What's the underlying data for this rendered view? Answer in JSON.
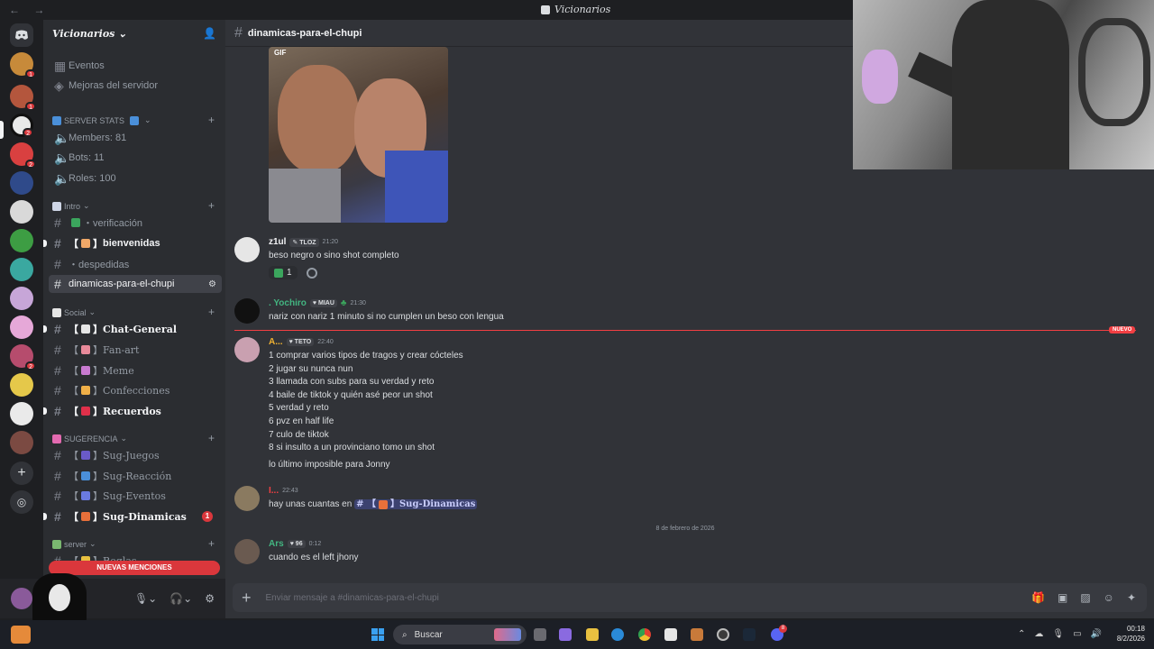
{
  "window": {
    "title": "Vicionarios",
    "nav": "← →"
  },
  "server": {
    "name": "Vicionarios"
  },
  "sidebar": {
    "top_items": [
      {
        "icon": "calendar-icon",
        "label": "Eventos"
      },
      {
        "icon": "boost-icon",
        "label": "Mejoras del servidor"
      }
    ],
    "categories": {
      "stats": "SERVER STATS",
      "intro": "Intro",
      "social": "Social",
      "sugerencia": "SUGERENCIA",
      "server": "server"
    },
    "stats_channels": [
      "Members: 81",
      "Bots: 11",
      "Roles: 100"
    ],
    "intro_channels": [
      {
        "name": "・verificación"
      },
      {
        "name": "bienvenidas",
        "bracket": true
      },
      {
        "name": "・despedidas"
      },
      {
        "name": "dinamicas-para-el-chupi"
      }
    ],
    "social_channels": [
      {
        "name": "Chat-General"
      },
      {
        "name": "Fan-art"
      },
      {
        "name": "Meme"
      },
      {
        "name": "Confecciones"
      },
      {
        "name": "Recuerdos"
      }
    ],
    "sug_channels": [
      {
        "name": "Sug-Juegos"
      },
      {
        "name": "Sug-Reacción"
      },
      {
        "name": "Sug-Eventos"
      },
      {
        "name": "Sug-Dinamicas",
        "mentions": "1"
      }
    ],
    "server_channels": [
      {
        "name": "Reglas"
      }
    ],
    "new_mentions": "NUEVAS MENCIONES"
  },
  "guild_badges": [
    "1",
    "1",
    "2",
    "2",
    "2"
  ],
  "channel": {
    "name": "dinamicas-para-el-chupi"
  },
  "messages": {
    "gif_label": "GIF",
    "m1": {
      "user": "z1ul",
      "tag": "TLOZ",
      "time": "21:20",
      "text": "beso negro o sino shot completo",
      "reaction_count": "1"
    },
    "m2": {
      "user": ". Yochiro",
      "tag": "MIAU",
      "time": "21:30",
      "text": "nariz con nariz 1 minuto si no cumplen un beso con lengua"
    },
    "new_label": "NUEVO",
    "m3": {
      "user": "A...",
      "tag": "TETO",
      "time": "22:40",
      "lines": [
        "1 comprar varios tipos de tragos y crear cócteles",
        "2 jugar su nunca nun",
        "3 llamada con subs para su verdad y reto",
        "4 baile de tiktok y quién asé peor un shot",
        "5 verdad y reto",
        "6 pvz en half life",
        "7 culo de tiktok",
        "8 si insulto a un provinciano tomo un shot"
      ],
      "extra": "lo último imposible para Jonny"
    },
    "m4": {
      "user": "I...",
      "time": "22:43",
      "text": "hay unas cuantas en",
      "mention": "Sug-Dinamicas"
    },
    "date_sep": "8 de febrero de 2026",
    "m5": {
      "user": "Ars",
      "tag": "96",
      "time": "0:12",
      "text": "cuando es el left jhony"
    }
  },
  "composer": {
    "placeholder": "Enviar mensaje a #dinamicas-para-el-chupi"
  },
  "taskbar": {
    "search": "Buscar",
    "time": "00:18",
    "date": "8/2/2026",
    "steam_badge": "8"
  },
  "colors": {
    "accent": "#5865f2",
    "danger": "#da373c",
    "online_green": "#23a55a"
  }
}
